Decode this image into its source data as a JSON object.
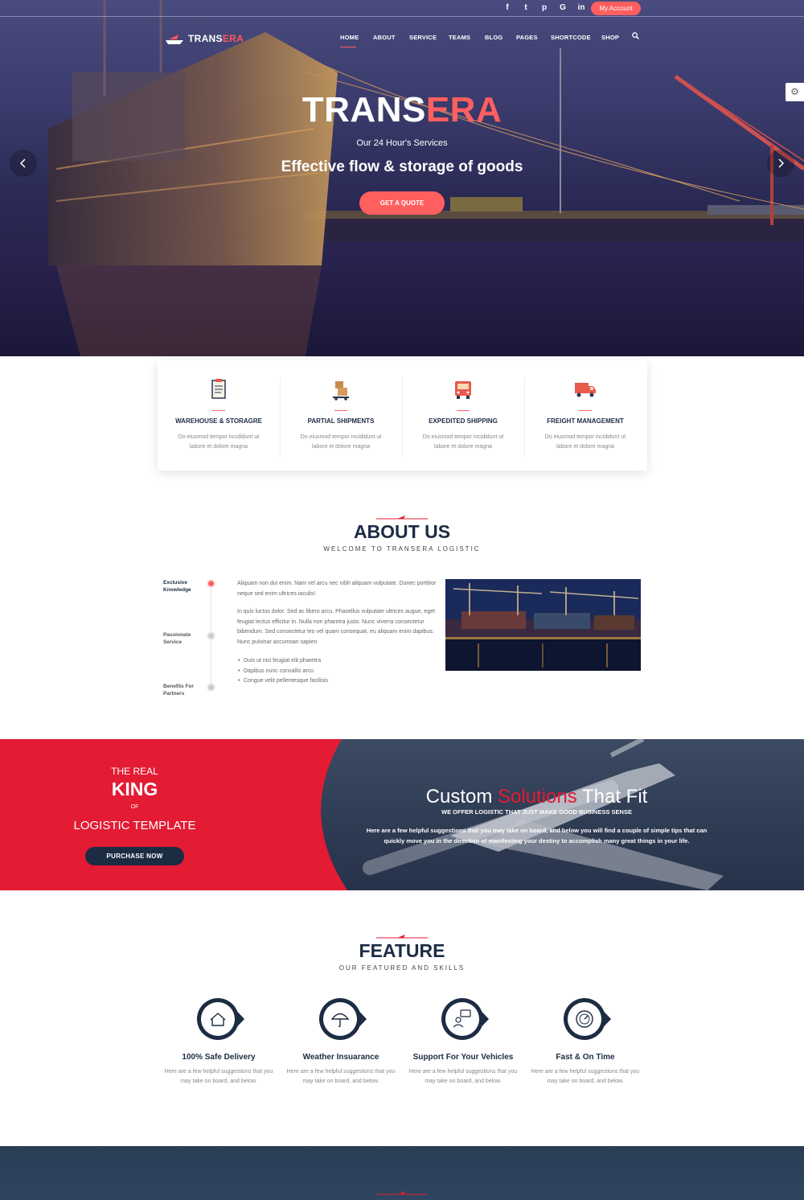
{
  "colors": {
    "accent": "#ff5f5f",
    "brand_red": "#e31b33",
    "navy": "#1c2c43"
  },
  "topbar": {
    "social": [
      {
        "icon": "facebook-icon",
        "glyph": "f"
      },
      {
        "icon": "twitter-icon",
        "glyph": "t"
      },
      {
        "icon": "pinterest-icon",
        "glyph": "p"
      },
      {
        "icon": "google-icon",
        "glyph": "G"
      },
      {
        "icon": "linkedin-icon",
        "glyph": "in"
      }
    ],
    "account_label": "My Account"
  },
  "header": {
    "logo": {
      "part1": "TRANS",
      "part2": "ERA"
    },
    "nav": [
      "HOME",
      "ABOUT",
      "SERVICE",
      "TEAMS",
      "BLOG",
      "PAGES",
      "SHORTCODE",
      "SHOP"
    ],
    "active_nav": "HOME"
  },
  "hero": {
    "title_part1": "TRANS",
    "title_part2": "ERA",
    "subtitle": "Our 24 Hour's Services",
    "headline": "Effective flow & storage of goods",
    "cta": "GET A QUOTE",
    "prev_icon": "chevron-left-icon",
    "next_icon": "chevron-right-icon"
  },
  "services": [
    {
      "icon": "clipboard-icon",
      "title": "WAREHOUSE & STORAGRE",
      "desc": "Do eiusmod tempor incididunt ut labore et dolore magna"
    },
    {
      "icon": "hand-truck-icon",
      "title": "PARTIAL SHIPMENTS",
      "desc": "Do eiusmod tempor incididunt ut labore et dolore magna"
    },
    {
      "icon": "truck-front-icon",
      "title": "EXPEDITED SHIPPING",
      "desc": "Do eiusmod tempor incididunt ut labore et dolore magna"
    },
    {
      "icon": "delivery-truck-icon",
      "title": "FREIGHT MANAGEMENT",
      "desc": "Do eiusmod tempor incididunt ut labore et dolore magna"
    }
  ],
  "about": {
    "title": "ABOUT US",
    "subtitle": "WELCOME TO TRANSERA LOGISTIC",
    "tabs": [
      "Exclusive Knowledge",
      "Passionate Service",
      "Benefits For Partners"
    ],
    "paragraph1": "Aliquam non dui enim. Nam vel arcu nec nibh aliquam vulputate. Donec porttitor neque sed enim ultrices iaculis!",
    "paragraph2": "In quis luctus dolor. Sed ac libero arcu. Phasellus vulputate ultrices augue, eget feugiat lectus efficitur in. Nulla non pharetra justo. Nunc viverra consectetur bibendum. Sed consectetur leo vel quam consequat, eu aliquam enim dapibus. Nunc pulvinar accumsan sapien",
    "bullets": [
      "Duis ut nisi feugiat elit pharetra",
      "Dapibus nunc convallis arcu",
      "Congue velit pellentesque facilisis"
    ]
  },
  "promo": {
    "line1": "THE REAL",
    "line2": "KING",
    "line3": "OF",
    "line4": "LOGISTIC TEMPLATE",
    "button": "PURCHASE NOW",
    "heading_part1": "Custom ",
    "heading_part2": "Solutions",
    "heading_part3": " That Fit",
    "tagline": "WE OFFER LOGISTIC THAT JUST MAKE GOOD BUSINESS SENSE",
    "text": "Here are a few helpful suggestions that you may take on board, and below you will find a couple of simple tips that can quickly move you in the direction of manifesting your destiny to accomplish many great things in your life."
  },
  "feature": {
    "title": "FEATURE",
    "subtitle": "OUR FEATURED AND SKILLS",
    "items": [
      {
        "icon": "house-icon",
        "title": "100% Safe Delivery",
        "desc": "Here are a few helpful suggestions that you may take on board, and below."
      },
      {
        "icon": "umbrella-icon",
        "title": "Weather Insuarance",
        "desc": "Here are a few helpful suggestions that you may take on board, and below."
      },
      {
        "icon": "support-icon",
        "title": "Support For Your Vehicles",
        "desc": "Here are a few helpful suggestions that you may take on board, and below."
      },
      {
        "icon": "speedometer-icon",
        "title": "Fast & On Time",
        "desc": "Here are a few helpful suggestions that you may take on board, and below."
      }
    ]
  }
}
